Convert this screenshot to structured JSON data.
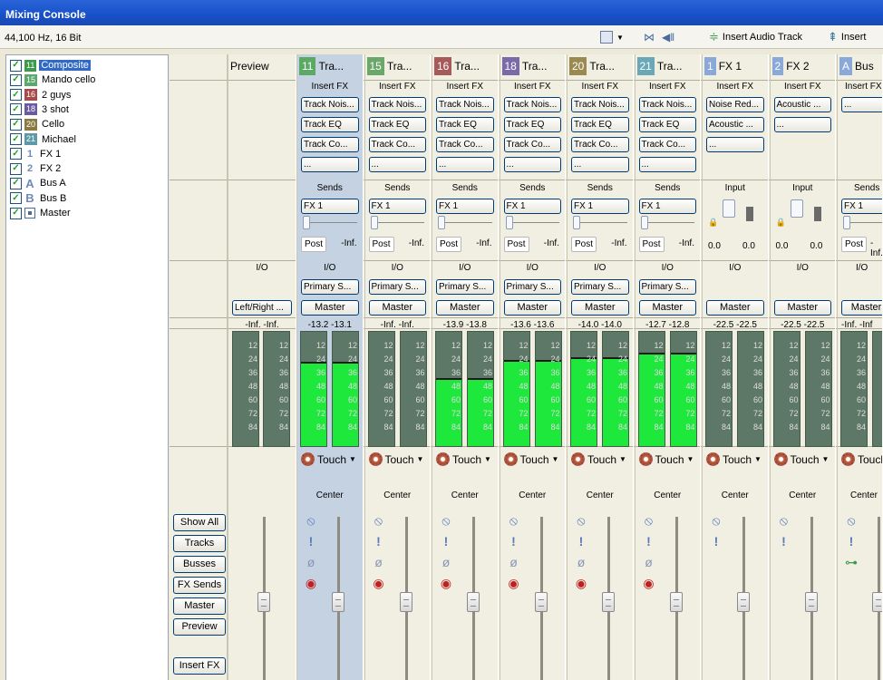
{
  "window": {
    "title": "Mixing Console"
  },
  "toolbar": {
    "sample_rate": "44,100 Hz, 16 Bit",
    "insert_audio_track": "Insert Audio Track",
    "insert_more": "Insert"
  },
  "tree": {
    "items": [
      {
        "num": "11",
        "name": "Composite",
        "color": "#3c9a4a",
        "selected": true
      },
      {
        "num": "15",
        "name": "Mando cello",
        "color": "#5aa86a"
      },
      {
        "num": "16",
        "name": "2 guys",
        "color": "#a84a4a"
      },
      {
        "num": "18",
        "name": "3 shot",
        "color": "#6a5aa0"
      },
      {
        "num": "20",
        "name": "Cello",
        "color": "#8a7a40"
      },
      {
        "num": "21",
        "name": "Michael",
        "color": "#5a9aa8"
      },
      {
        "num": "1",
        "name": "FX 1",
        "kind": "fx"
      },
      {
        "num": "2",
        "name": "FX 2",
        "kind": "fx"
      },
      {
        "num": "A",
        "name": "Bus A",
        "kind": "bus"
      },
      {
        "num": "B",
        "name": "Bus B",
        "kind": "bus"
      },
      {
        "num": "",
        "name": "Master",
        "kind": "master"
      }
    ]
  },
  "sidebar": {
    "buttons": [
      "Show All",
      "Tracks",
      "Busses",
      "FX Sends",
      "Master",
      "Preview"
    ],
    "insert_fx": "Insert FX"
  },
  "labels": {
    "insert_fx": "Insert FX",
    "sends": "Sends",
    "input": "Input",
    "io": "I/O",
    "post": "Post",
    "inf": "-Inf.",
    "center": "Center",
    "touch": "Touch",
    "more": "...",
    "input_val_l": "0.0",
    "input_val_r": "0.0"
  },
  "meter_marks": [
    "12",
    "24",
    "36",
    "48",
    "60",
    "72",
    "84"
  ],
  "preview": {
    "name": "Preview",
    "io": "I/O",
    "output": "Left/Right ...",
    "peak": "-Inf.  -Inf."
  },
  "channels": [
    {
      "num": "11",
      "name": "Tra...",
      "color": "#5ca865",
      "fx": [
        "Track Nois...",
        "Track EQ",
        "Track Co...",
        "..."
      ],
      "send": "FX 1",
      "io_in": "Primary S...",
      "out": "Master",
      "peak": "-13.2  -13.1",
      "level": 0.72,
      "selected": true
    },
    {
      "num": "15",
      "name": "Tra...",
      "color": "#6aa86a",
      "fx": [
        "Track Nois...",
        "Track EQ",
        "Track Co...",
        "..."
      ],
      "send": "FX 1",
      "io_in": "Primary S...",
      "out": "Master",
      "peak": "-Inf.  -Inf.",
      "level": 0
    },
    {
      "num": "16",
      "name": "Tra...",
      "color": "#a85a5a",
      "fx": [
        "Track Nois...",
        "Track EQ",
        "Track Co...",
        "..."
      ],
      "send": "FX 1",
      "io_in": "Primary S...",
      "out": "Master",
      "peak": "-13.9  -13.8",
      "level": 0.58
    },
    {
      "num": "18",
      "name": "Tra...",
      "color": "#7a6aa8",
      "fx": [
        "Track Nois...",
        "Track EQ",
        "Track Co...",
        "..."
      ],
      "send": "FX 1",
      "io_in": "Primary S...",
      "out": "Master",
      "peak": "-13.6  -13.6",
      "level": 0.74
    },
    {
      "num": "20",
      "name": "Tra...",
      "color": "#9a8a50",
      "fx": [
        "Track Nois...",
        "Track EQ",
        "Track Co...",
        "..."
      ],
      "send": "FX 1",
      "io_in": "Primary S...",
      "out": "Master",
      "peak": "-14.0  -14.0",
      "level": 0.76
    },
    {
      "num": "21",
      "name": "Tra...",
      "color": "#6aa8b8",
      "fx": [
        "Track Nois...",
        "Track EQ",
        "Track Co...",
        "..."
      ],
      "send": "FX 1",
      "io_in": "Primary S...",
      "out": "Master",
      "peak": "-12.7  -12.8",
      "level": 0.8
    }
  ],
  "fx_channels": [
    {
      "num": "1",
      "name": "FX 1",
      "fx": [
        "Noise Red...",
        "Acoustic ...",
        "..."
      ],
      "out": "Master",
      "peak": "-22.5  -22.5",
      "io": "I/O"
    },
    {
      "num": "2",
      "name": "FX 2",
      "fx": [
        "Acoustic ...",
        "..."
      ],
      "out": "Master",
      "peak": "-22.5  -22.5",
      "io": "I/O"
    }
  ],
  "bus": {
    "num": "A",
    "name": "Bus",
    "fx": [
      "..."
    ],
    "send": "FX 1",
    "out": "Master",
    "peak": "-Inf.  -Inf",
    "io": "I/O",
    "touch": "Touch",
    "center": "Center"
  }
}
